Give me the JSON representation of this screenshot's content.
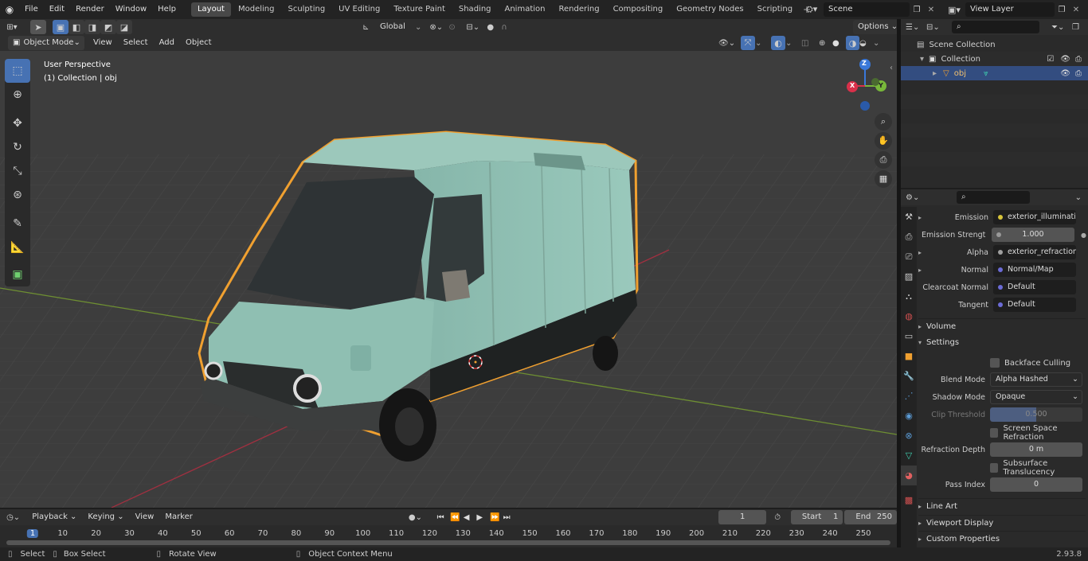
{
  "topbar": {
    "menus": [
      "File",
      "Edit",
      "Render",
      "Window",
      "Help"
    ],
    "workspaces": [
      "Layout",
      "Modeling",
      "Sculpting",
      "UV Editing",
      "Texture Paint",
      "Shading",
      "Animation",
      "Rendering",
      "Compositing",
      "Geometry Nodes",
      "Scripting"
    ],
    "active_workspace": "Layout",
    "scene": "Scene",
    "view_layer": "View Layer"
  },
  "tool_header": {
    "orientation": "Global",
    "options": "Options"
  },
  "viewport_header": {
    "mode": "Object Mode",
    "menus": [
      "View",
      "Select",
      "Add",
      "Object"
    ]
  },
  "viewport": {
    "perspective": "User Perspective",
    "collection_info": "(1) Collection | obj",
    "gizmo_axes": [
      "X",
      "Y",
      "Z"
    ]
  },
  "outliner": {
    "scene_collection": "Scene Collection",
    "collection": "Collection",
    "object": "obj"
  },
  "properties": {
    "rows": [
      {
        "label": "Emission",
        "value": "exterior_illumination...",
        "dot": "#d8c53a",
        "expand": true
      },
      {
        "label": "Emission Strengt",
        "value": "1.000",
        "dot": "#999999",
        "expand": false,
        "numeric": true
      },
      {
        "label": "Alpha",
        "value": "exterior_refraction_i...",
        "dot": "#a0a0a0",
        "expand": true
      },
      {
        "label": "Normal",
        "value": "Normal/Map",
        "dot": "#6b6bd6",
        "expand": true
      },
      {
        "label": "Clearcoat Normal",
        "value": "Default",
        "dot": "#6b6bd6",
        "expand": false
      },
      {
        "label": "Tangent",
        "value": "Default",
        "dot": "#6b6bd6",
        "expand": false
      }
    ],
    "sections": {
      "volume": "Volume",
      "settings": "Settings",
      "line_art": "Line Art",
      "viewport_display": "Viewport Display",
      "custom_properties": "Custom Properties"
    },
    "backface_culling": "Backface Culling",
    "blend_mode_label": "Blend Mode",
    "blend_mode": "Alpha Hashed",
    "shadow_mode_label": "Shadow Mode",
    "shadow_mode": "Opaque",
    "clip_threshold_label": "Clip Threshold",
    "clip_threshold": "0.500",
    "screen_space_refraction": "Screen Space Refraction",
    "refraction_depth_label": "Refraction Depth",
    "refraction_depth": "0 m",
    "subsurface_translucency": "Subsurface Translucency",
    "pass_index_label": "Pass Index",
    "pass_index": "0"
  },
  "timeline": {
    "menus": [
      "Playback",
      "Keying",
      "View",
      "Marker"
    ],
    "current_frame": "1",
    "start_label": "Start",
    "start": "1",
    "end_label": "End",
    "end": "250",
    "ticks": [
      "1",
      "10",
      "20",
      "30",
      "40",
      "50",
      "60",
      "70",
      "80",
      "90",
      "100",
      "110",
      "120",
      "130",
      "140",
      "150",
      "160",
      "170",
      "180",
      "190",
      "200",
      "210",
      "220",
      "230",
      "240",
      "250"
    ]
  },
  "statusbar": {
    "select": "Select",
    "box_select": "Box Select",
    "rotate_view": "Rotate View",
    "context_menu": "Object Context Menu",
    "version": "2.93.8"
  },
  "colors": {
    "accent": "#4772b3",
    "selection_outline": "#f0a030",
    "van_body": "#8fbfb2",
    "x_axis": "#d9304a",
    "y_axis": "#78b83a",
    "z_axis": "#3a78d9"
  }
}
